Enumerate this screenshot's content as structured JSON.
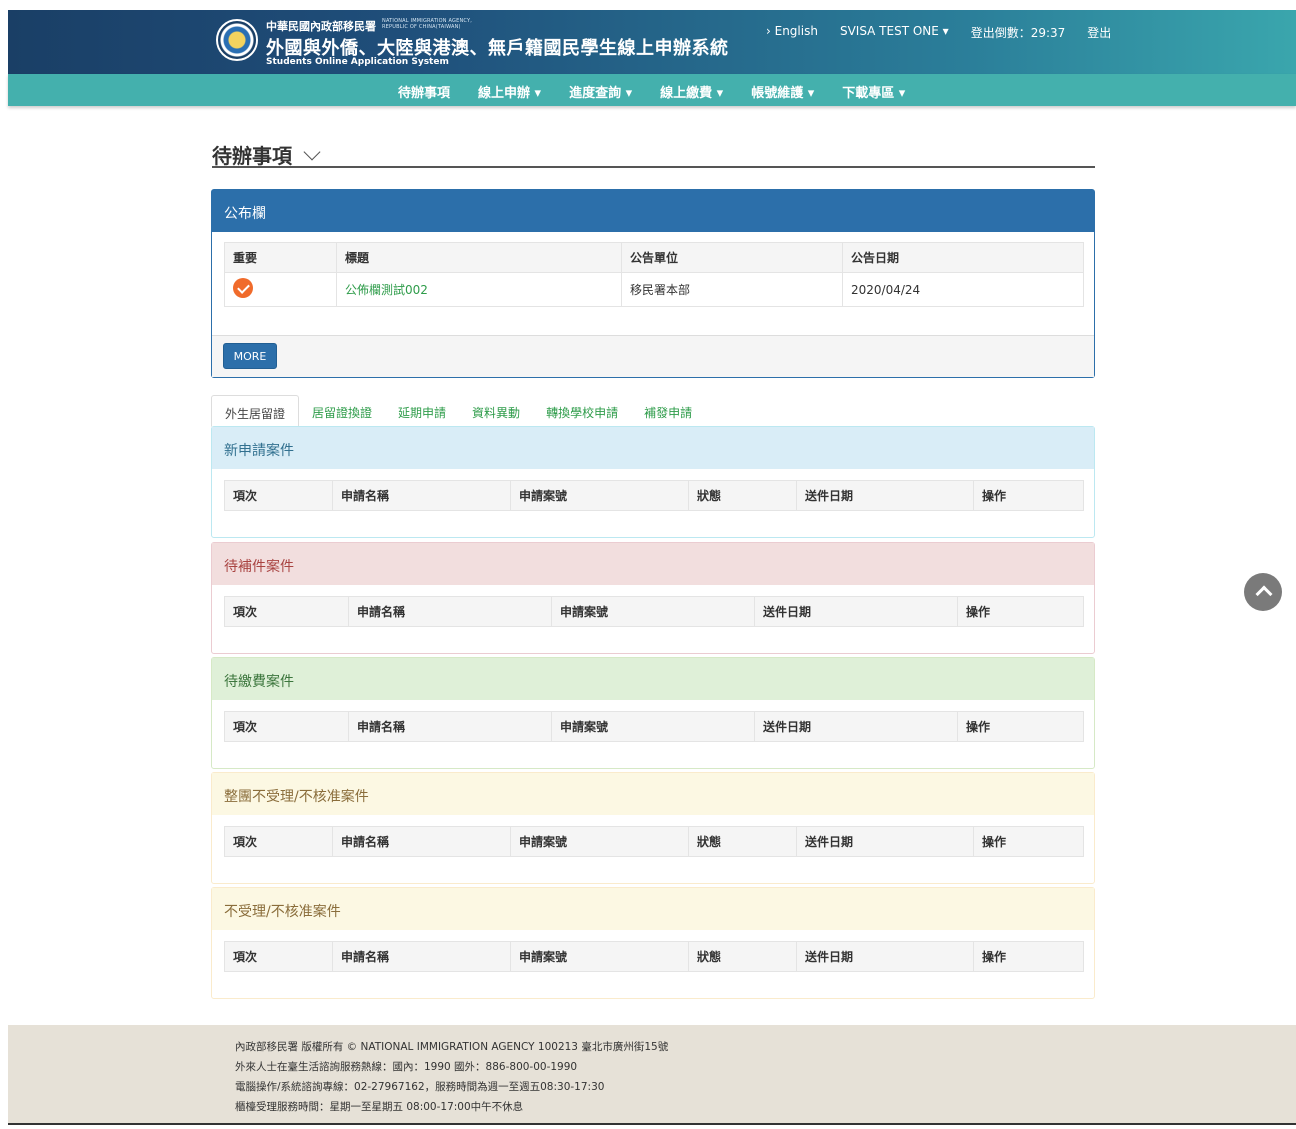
{
  "header": {
    "agency_zh": "中華民國內政部移民署",
    "agency_en_line1": "NATIONAL IMMIGRATION AGENCY,",
    "agency_en_line2": "REPUBLIC OF CHINA(TAIWAN)",
    "system_title": "外國與外僑、大陸與港澳、無戶籍國民學生線上申辦系統",
    "system_en": "Students Online Application System",
    "english_link": "› English",
    "user_menu": "SVISA TEST ONE ▾",
    "logout_countdown": "登出倒數：29:37",
    "logout": "登出"
  },
  "nav": {
    "items": [
      "待辦事項",
      "線上申辦 ▾",
      "進度查詢 ▾",
      "線上繳費 ▾",
      "帳號維護 ▾",
      "下載專區 ▾"
    ]
  },
  "page_title": "待辦事項",
  "bulletin": {
    "heading": "公布欄",
    "columns": [
      "重要",
      "標題",
      "公告單位",
      "公告日期"
    ],
    "rows": [
      {
        "title": "公佈欄測試002",
        "unit": "移民署本部",
        "date": "2020/04/24"
      }
    ],
    "more_label": "MORE"
  },
  "tabs": [
    "外生居留證",
    "居留證換證",
    "延期申請",
    "資料異動",
    "轉換學校申請",
    "補發申請"
  ],
  "panels": {
    "new": {
      "heading": "新申請案件",
      "columns": [
        "項次",
        "申請名稱",
        "申請案號",
        "狀態",
        "送件日期",
        "操作"
      ]
    },
    "supplement": {
      "heading": "待補件案件",
      "columns": [
        "項次",
        "申請名稱",
        "申請案號",
        "送件日期",
        "操作"
      ]
    },
    "payment": {
      "heading": "待繳費案件",
      "columns": [
        "項次",
        "申請名稱",
        "申請案號",
        "送件日期",
        "操作"
      ]
    },
    "rejected_group": {
      "heading": "整團不受理/不核准案件",
      "columns": [
        "項次",
        "申請名稱",
        "申請案號",
        "狀態",
        "送件日期",
        "操作"
      ]
    },
    "rejected": {
      "heading": "不受理/不核准案件",
      "columns": [
        "項次",
        "申請名稱",
        "申請案號",
        "狀態",
        "送件日期",
        "操作"
      ]
    }
  },
  "footer": {
    "line1": "內政部移民署 版權所有 © NATIONAL IMMIGRATION AGENCY 100213 臺北市廣州街15號",
    "line2": "外來人士在臺生活諮詢服務熱線：國內：1990 國外：886-800-00-1990",
    "line3": "電腦操作/系統諮詢專線：02-27967162，服務時間為週一至週五08:30-17:30",
    "line4": "櫃檯受理服務時間：星期一至星期五 08:00-17:00中午不休息"
  },
  "colors": {
    "header_dark": "#1a3f66",
    "nav_teal": "#44b0ad",
    "primary": "#2c6faa",
    "link_green": "#2e9c4a",
    "important_orange": "#f06b2b"
  },
  "icons": {
    "important": "check-circle-icon",
    "title_toggle": "chevron-down-icon",
    "scroll_top": "chevron-up-icon"
  }
}
